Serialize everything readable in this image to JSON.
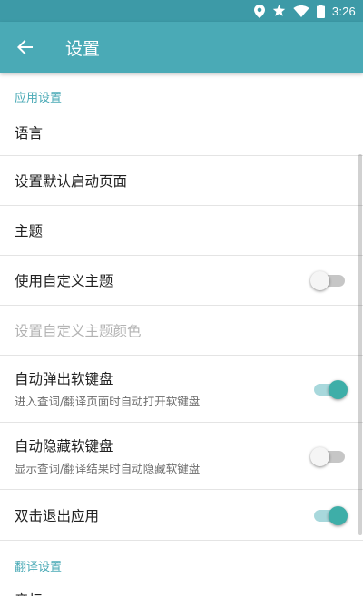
{
  "status_bar": {
    "time": "3:26",
    "icons": [
      "location-icon",
      "star-icon",
      "wifi-icon",
      "battery-icon"
    ]
  },
  "app_bar": {
    "title": "设置",
    "back_icon": "arrow-left-icon"
  },
  "sections": [
    {
      "header": "应用设置",
      "items": [
        {
          "title": "语言"
        },
        {
          "title": "设置默认启动页面"
        },
        {
          "title": "主题"
        },
        {
          "title": "使用自定义主题",
          "switch": "off"
        },
        {
          "title": "设置自定义主题颜色",
          "disabled": true
        },
        {
          "title": "自动弹出软键盘",
          "subtitle": "进入查词/翻译页面时自动打开软键盘",
          "switch": "on"
        },
        {
          "title": "自动隐藏软键盘",
          "subtitle": "显示查词/翻译结果时自动隐藏软键盘",
          "switch": "off"
        },
        {
          "title": "双击退出应用",
          "switch": "on"
        }
      ]
    },
    {
      "header": "翻译设置",
      "items": [
        {
          "title": "音标"
        }
      ]
    }
  ],
  "colors": {
    "accent": "#4aaab6",
    "status_bar": "#3d9aa7",
    "switch_on": "#3eaea8"
  }
}
